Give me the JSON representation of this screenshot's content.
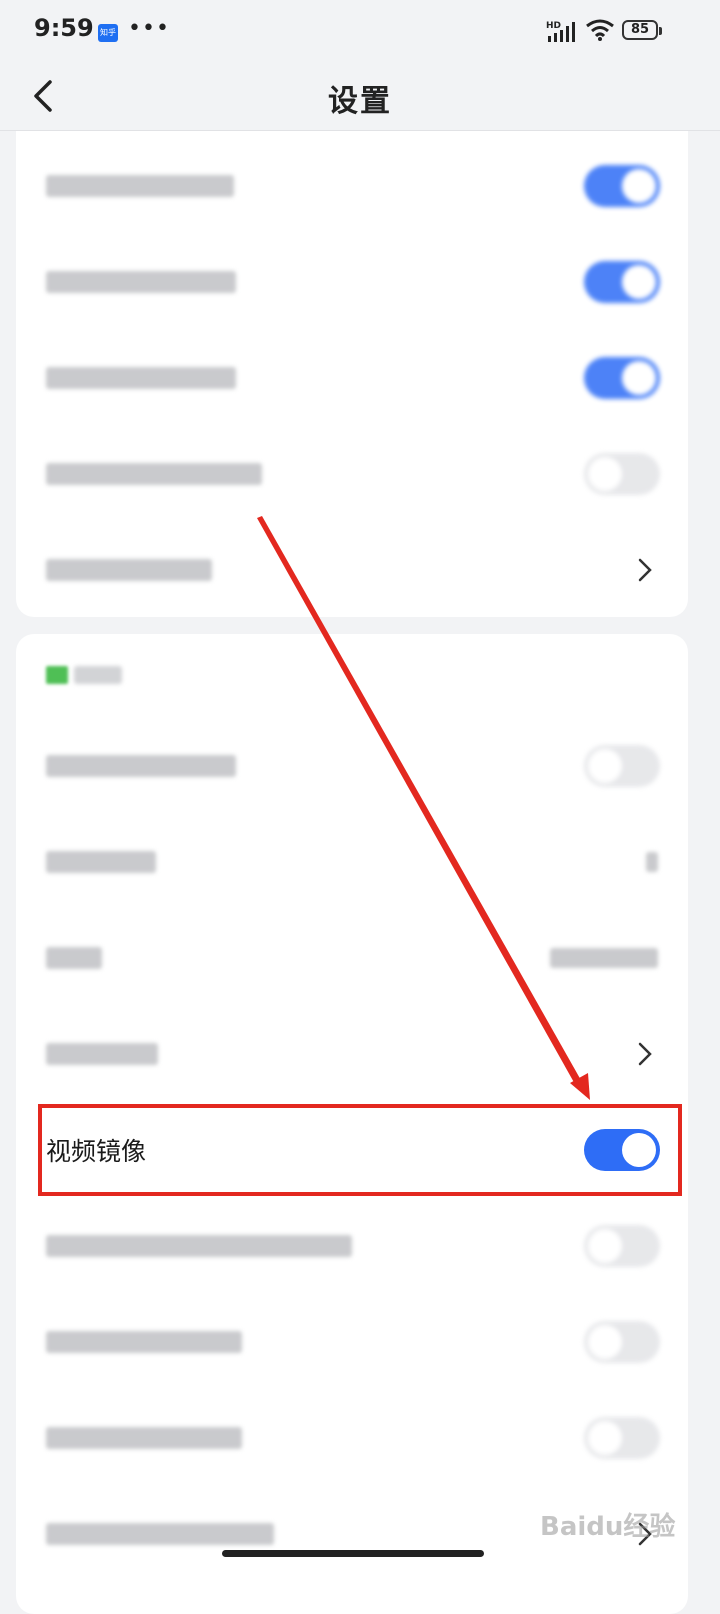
{
  "status_bar": {
    "time": "9:59",
    "app_badge": "知乎",
    "more": "•••",
    "network": "HD",
    "battery": "85"
  },
  "nav": {
    "back_icon": "chevron-left-icon",
    "title": "设置"
  },
  "settings": {
    "group1": [
      {
        "label_blurred": true,
        "control": "toggle",
        "state": "on"
      },
      {
        "label_blurred": true,
        "control": "toggle",
        "state": "on"
      },
      {
        "label_blurred": true,
        "control": "toggle",
        "state": "on"
      },
      {
        "label_blurred": true,
        "control": "toggle",
        "state": "off"
      },
      {
        "label_blurred": true,
        "control": "chevron"
      }
    ],
    "group2": [
      {
        "label_blurred": true,
        "control": "toggle",
        "state": "off"
      },
      {
        "label_blurred": true,
        "control": "value",
        "value_blurred": true
      },
      {
        "label_blurred": true,
        "control": "value",
        "value_blurred": true
      },
      {
        "label_blurred": true,
        "control": "chevron"
      },
      {
        "label": "视频镜像",
        "control": "toggle",
        "state": "on"
      },
      {
        "label_blurred": true,
        "control": "toggle",
        "state": "off"
      },
      {
        "label_blurred": true,
        "control": "toggle",
        "state": "off"
      },
      {
        "label_blurred": true,
        "control": "toggle",
        "state": "off"
      },
      {
        "label_blurred": true,
        "control": "chevron"
      }
    ],
    "video_mirror_label": "视频镜像"
  },
  "annotation": {
    "color": "#e3281f"
  },
  "watermark": "Baidu经验",
  "colors": {
    "accent": "#2e6df6",
    "background": "#f2f3f5",
    "annotation_red": "#e3281f"
  }
}
